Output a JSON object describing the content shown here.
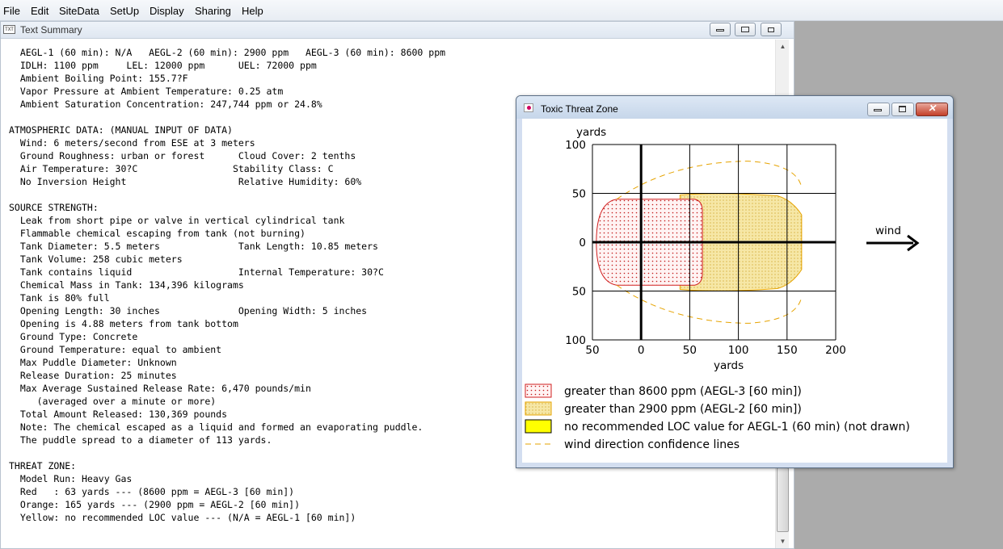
{
  "menu": [
    "File",
    "Edit",
    "SiteData",
    "SetUp",
    "Display",
    "Sharing",
    "Help"
  ],
  "text_window": {
    "title": "Text Summary",
    "lines": [
      "  AEGL-1 (60 min): N/A   AEGL-2 (60 min): 2900 ppm   AEGL-3 (60 min): 8600 ppm",
      "  IDLH: 1100 ppm     LEL: 12000 ppm      UEL: 72000 ppm",
      "  Ambient Boiling Point: 155.7?F",
      "  Vapor Pressure at Ambient Temperature: 0.25 atm",
      "  Ambient Saturation Concentration: 247,744 ppm or 24.8%",
      "",
      "ATMOSPHERIC DATA: (MANUAL INPUT OF DATA)",
      "  Wind: 6 meters/second from ESE at 3 meters",
      "  Ground Roughness: urban or forest      Cloud Cover: 2 tenths",
      "  Air Temperature: 30?C                 Stability Class: C",
      "  No Inversion Height                    Relative Humidity: 60%",
      "",
      "SOURCE STRENGTH:",
      "  Leak from short pipe or valve in vertical cylindrical tank",
      "  Flammable chemical escaping from tank (not burning)",
      "  Tank Diameter: 5.5 meters              Tank Length: 10.85 meters",
      "  Tank Volume: 258 cubic meters",
      "  Tank contains liquid                   Internal Temperature: 30?C",
      "  Chemical Mass in Tank: 134,396 kilograms",
      "  Tank is 80% full",
      "  Opening Length: 30 inches              Opening Width: 5 inches",
      "  Opening is 4.88 meters from tank bottom",
      "  Ground Type: Concrete",
      "  Ground Temperature: equal to ambient",
      "  Max Puddle Diameter: Unknown",
      "  Release Duration: 25 minutes",
      "  Max Average Sustained Release Rate: 6,470 pounds/min",
      "     (averaged over a minute or more)",
      "  Total Amount Released: 130,369 pounds",
      "  Note: The chemical escaped as a liquid and formed an evaporating puddle.",
      "  The puddle spread to a diameter of 113 yards.",
      "",
      "THREAT ZONE:",
      "  Model Run: Heavy Gas",
      "  Red   : 63 yards --- (8600 ppm = AEGL-3 [60 min])",
      "  Orange: 165 yards --- (2900 ppm = AEGL-2 [60 min])",
      "  Yellow: no recommended LOC value --- (N/A = AEGL-1 [60 min])"
    ]
  },
  "toxic_window": {
    "title": "Toxic Threat Zone",
    "wind_label": "wind",
    "legend": [
      {
        "label": "greater than 8600 ppm (AEGL-3 [60 min])",
        "swatch": "red-dots"
      },
      {
        "label": "greater than 2900 ppm (AEGL-2 [60 min])",
        "swatch": "orange-dots"
      },
      {
        "label": "no recommended LOC value for AEGL-1 (60 min) (not drawn)",
        "swatch": "yellow-solid"
      },
      {
        "label": "wind direction confidence lines",
        "swatch": "dashed-line"
      }
    ]
  },
  "chart_data": {
    "type": "area",
    "ylabel": "yards",
    "xlabel": "yards",
    "x_ticks": [
      "50",
      "0",
      "50",
      "100",
      "150",
      "200"
    ],
    "y_ticks": [
      "100",
      "50",
      "0",
      "50",
      "100"
    ],
    "xlim": [
      -50,
      200
    ],
    "ylim": [
      -100,
      100
    ],
    "grid": true,
    "zones": [
      {
        "name": "AEGL-3",
        "reach_yards": 63,
        "color": "#d11f1f"
      },
      {
        "name": "AEGL-2",
        "reach_yards": 165,
        "color": "#e6a300"
      }
    ]
  },
  "colors": {
    "red_zone": "#d11f1f",
    "orange_zone": "#e6a300",
    "yellow": "#ffff00",
    "confidence": "#e6a300"
  }
}
